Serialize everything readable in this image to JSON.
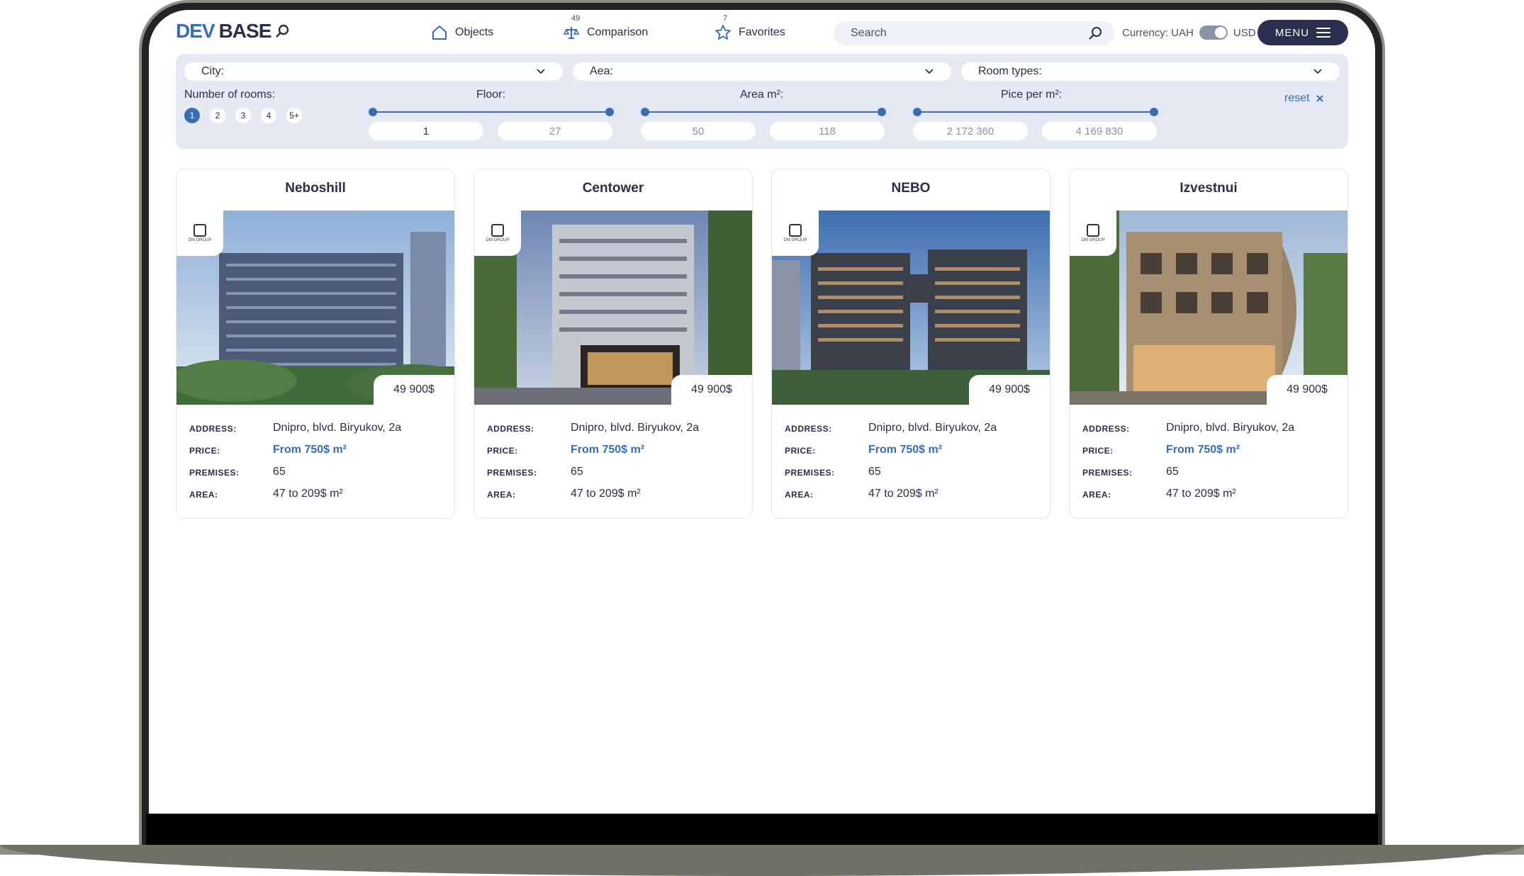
{
  "logo": {
    "part1": "DEV",
    "part2": "BASE"
  },
  "nav": {
    "objects": "Objects",
    "comparison": "Comparison",
    "comparison_count": "49",
    "favorites": "Favorites",
    "favorites_count": "7"
  },
  "search": {
    "placeholder": "Search"
  },
  "currency": {
    "label": "Currency: UAH",
    "alt": "USD"
  },
  "menu": {
    "label": "MENU"
  },
  "filters": {
    "city": "City:",
    "area_dropdown": "Aea:",
    "room_types": "Room types:",
    "rooms_label": "Number of rooms:",
    "rooms": [
      "1",
      "2",
      "3",
      "4",
      "5+"
    ],
    "floor_label": "Floor:",
    "floor_min": "1",
    "floor_max": "27",
    "area_label": "Area m²:",
    "area_min": "50",
    "area_max": "118",
    "price_label": "Pice per m²:",
    "price_min": "2 172 360",
    "price_max": "4 169 830",
    "reset": "reset"
  },
  "spec_labels": {
    "address": "ADDRESS:",
    "price": "PRICE:",
    "premises": "PREMISES:",
    "area": "AREA:"
  },
  "cards": [
    {
      "title": "Neboshill",
      "badge": "49 900$",
      "address": "Dnipro, blvd. Biryukov, 2a",
      "price": "From 750$ m²",
      "premises": "65",
      "area": "47 to 209$ m²",
      "developer": "DM GROUP"
    },
    {
      "title": "Centower",
      "badge": "49 900$",
      "address": "Dnipro, blvd. Biryukov, 2a",
      "price": "From 750$ m²",
      "premises": "65",
      "area": "47 to 209$ m²",
      "developer": "DM GROUP"
    },
    {
      "title": "NEBO",
      "badge": "49 900$",
      "address": "Dnipro, blvd. Biryukov, 2a",
      "price": "From 750$ m²",
      "premises": "65",
      "area": "47 to 209$ m²",
      "developer": "DM GROUP"
    },
    {
      "title": "Izvestnui",
      "badge": "49 900$",
      "address": "Dnipro, blvd. Biryukov, 2a",
      "price": "From 750$ m²",
      "premises": "65",
      "area": "47 to 209$ m²",
      "developer": "DM GROUP"
    }
  ],
  "colors": {
    "accent": "#3a6cb5",
    "navy": "#2b2f4f",
    "panel": "#e4e9f3"
  }
}
